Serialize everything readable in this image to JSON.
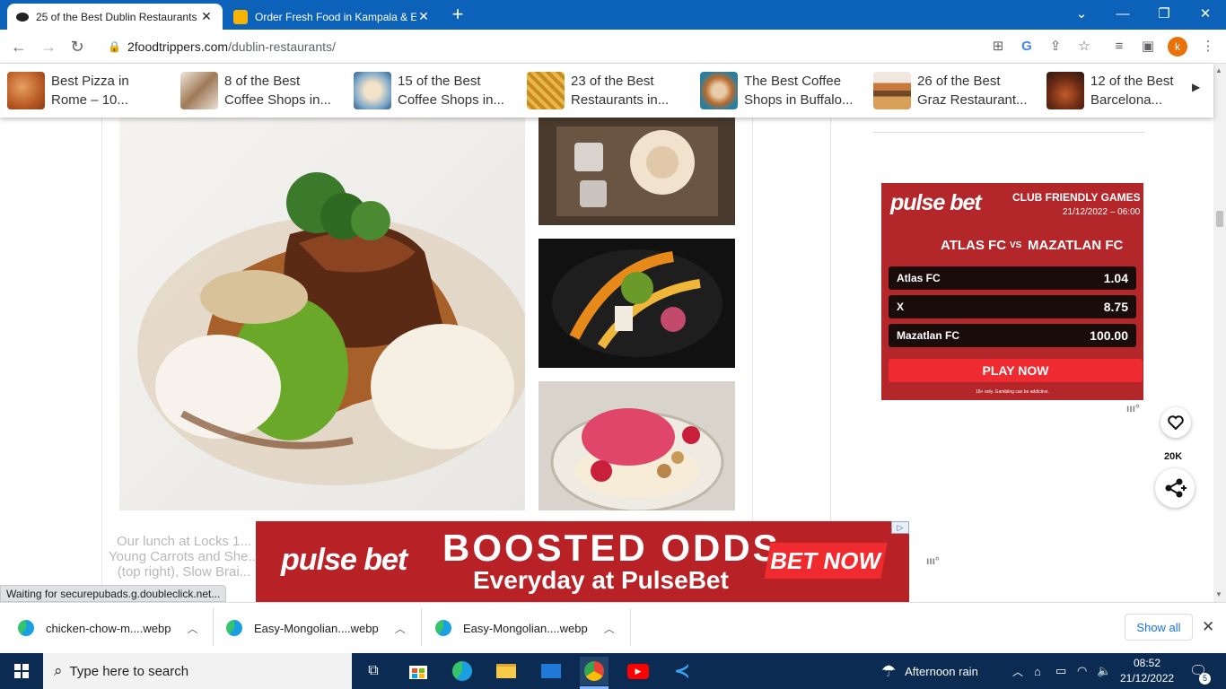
{
  "browser": {
    "tabs": [
      {
        "title": "25 of the Best Dublin Restaurants",
        "active": true
      },
      {
        "title": "Order Fresh Food in Kampala & E",
        "active": false
      }
    ],
    "new_tab": "+",
    "url_host": "2foodtrippers.com",
    "url_path": "/dublin-restaurants/",
    "profile_initial": "k"
  },
  "related": [
    {
      "line1": "Best Pizza in",
      "line2": "Rome – 10..."
    },
    {
      "line1": "8 of the Best",
      "line2": "Coffee Shops in..."
    },
    {
      "line1": "15 of the Best",
      "line2": "Coffee Shops in..."
    },
    {
      "line1": "23 of the Best",
      "line2": "Restaurants in..."
    },
    {
      "line1": "The Best Coffee",
      "line2": "Shops in Buffalo..."
    },
    {
      "line1": "26 of the Best",
      "line2": "Graz Restaurant..."
    },
    {
      "line1": "12 of the Best",
      "line2": "Barcelona..."
    }
  ],
  "article": {
    "caption_partial": "Our lunch at Locks 1... Young Carrots and She... (top right), Slow Brai..."
  },
  "ad_right": {
    "brand": "pulse bet",
    "event": "CLUB FRIENDLY GAMES",
    "datetime": "21/12/2022 – 06:00",
    "team_home": "ATLAS FC",
    "vs": "VS",
    "team_away": "MAZATLAN FC",
    "odds": [
      {
        "label": "Atlas FC",
        "value": "1.04"
      },
      {
        "label": "X",
        "value": "8.75"
      },
      {
        "label": "Mazatlan FC",
        "value": "100.00"
      }
    ],
    "cta": "PLAY NOW",
    "disclaimer": "18+ only. Gambling can be addictive."
  },
  "ad_bottom": {
    "brand": "pulse bet",
    "headline": "BOOSTED ODDS",
    "subline": "Everyday at PulseBet",
    "cta": "BET NOW"
  },
  "social": {
    "like_count": "20K"
  },
  "status_text": "Waiting for securepubads.g.doubleclick.net...",
  "downloads": [
    {
      "name": "chicken-chow-m....webp"
    },
    {
      "name": "Easy-Mongolian....webp"
    },
    {
      "name": "Easy-Mongolian....webp"
    }
  ],
  "show_all": "Show all",
  "taskbar": {
    "search_placeholder": "Type here to search",
    "weather": "Afternoon rain",
    "time": "08:52",
    "date": "21/12/2022",
    "notifications": "5"
  },
  "colors": {
    "titlebar": "#0b62b8",
    "pulsebet_red": "#b3262a",
    "taskbar": "#0b2b52"
  }
}
